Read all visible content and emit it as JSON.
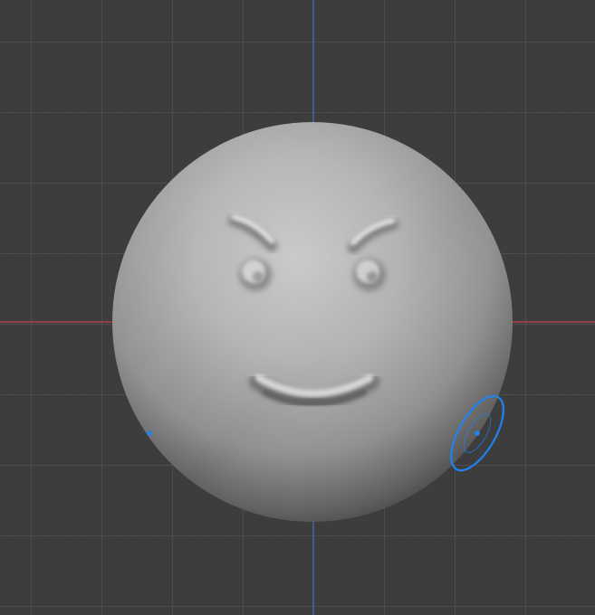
{
  "viewport": {
    "mode": "3d-sculpt-view",
    "background_color": "#3d3d3d",
    "grid_color": "#4e4e4e",
    "x_axis_color": "#c6414e",
    "y_axis_color": "#3d6cad"
  },
  "object": {
    "shape": "sphere",
    "features": [
      "eyebrow-left",
      "eyebrow-right",
      "eye-left",
      "eye-right",
      "smile"
    ],
    "base_color": "#a9a9a9"
  },
  "brush_cursor": {
    "color": "#1e84f0",
    "shape": "ellipse"
  },
  "stroke_dot": {
    "color": "#1e84f0"
  }
}
